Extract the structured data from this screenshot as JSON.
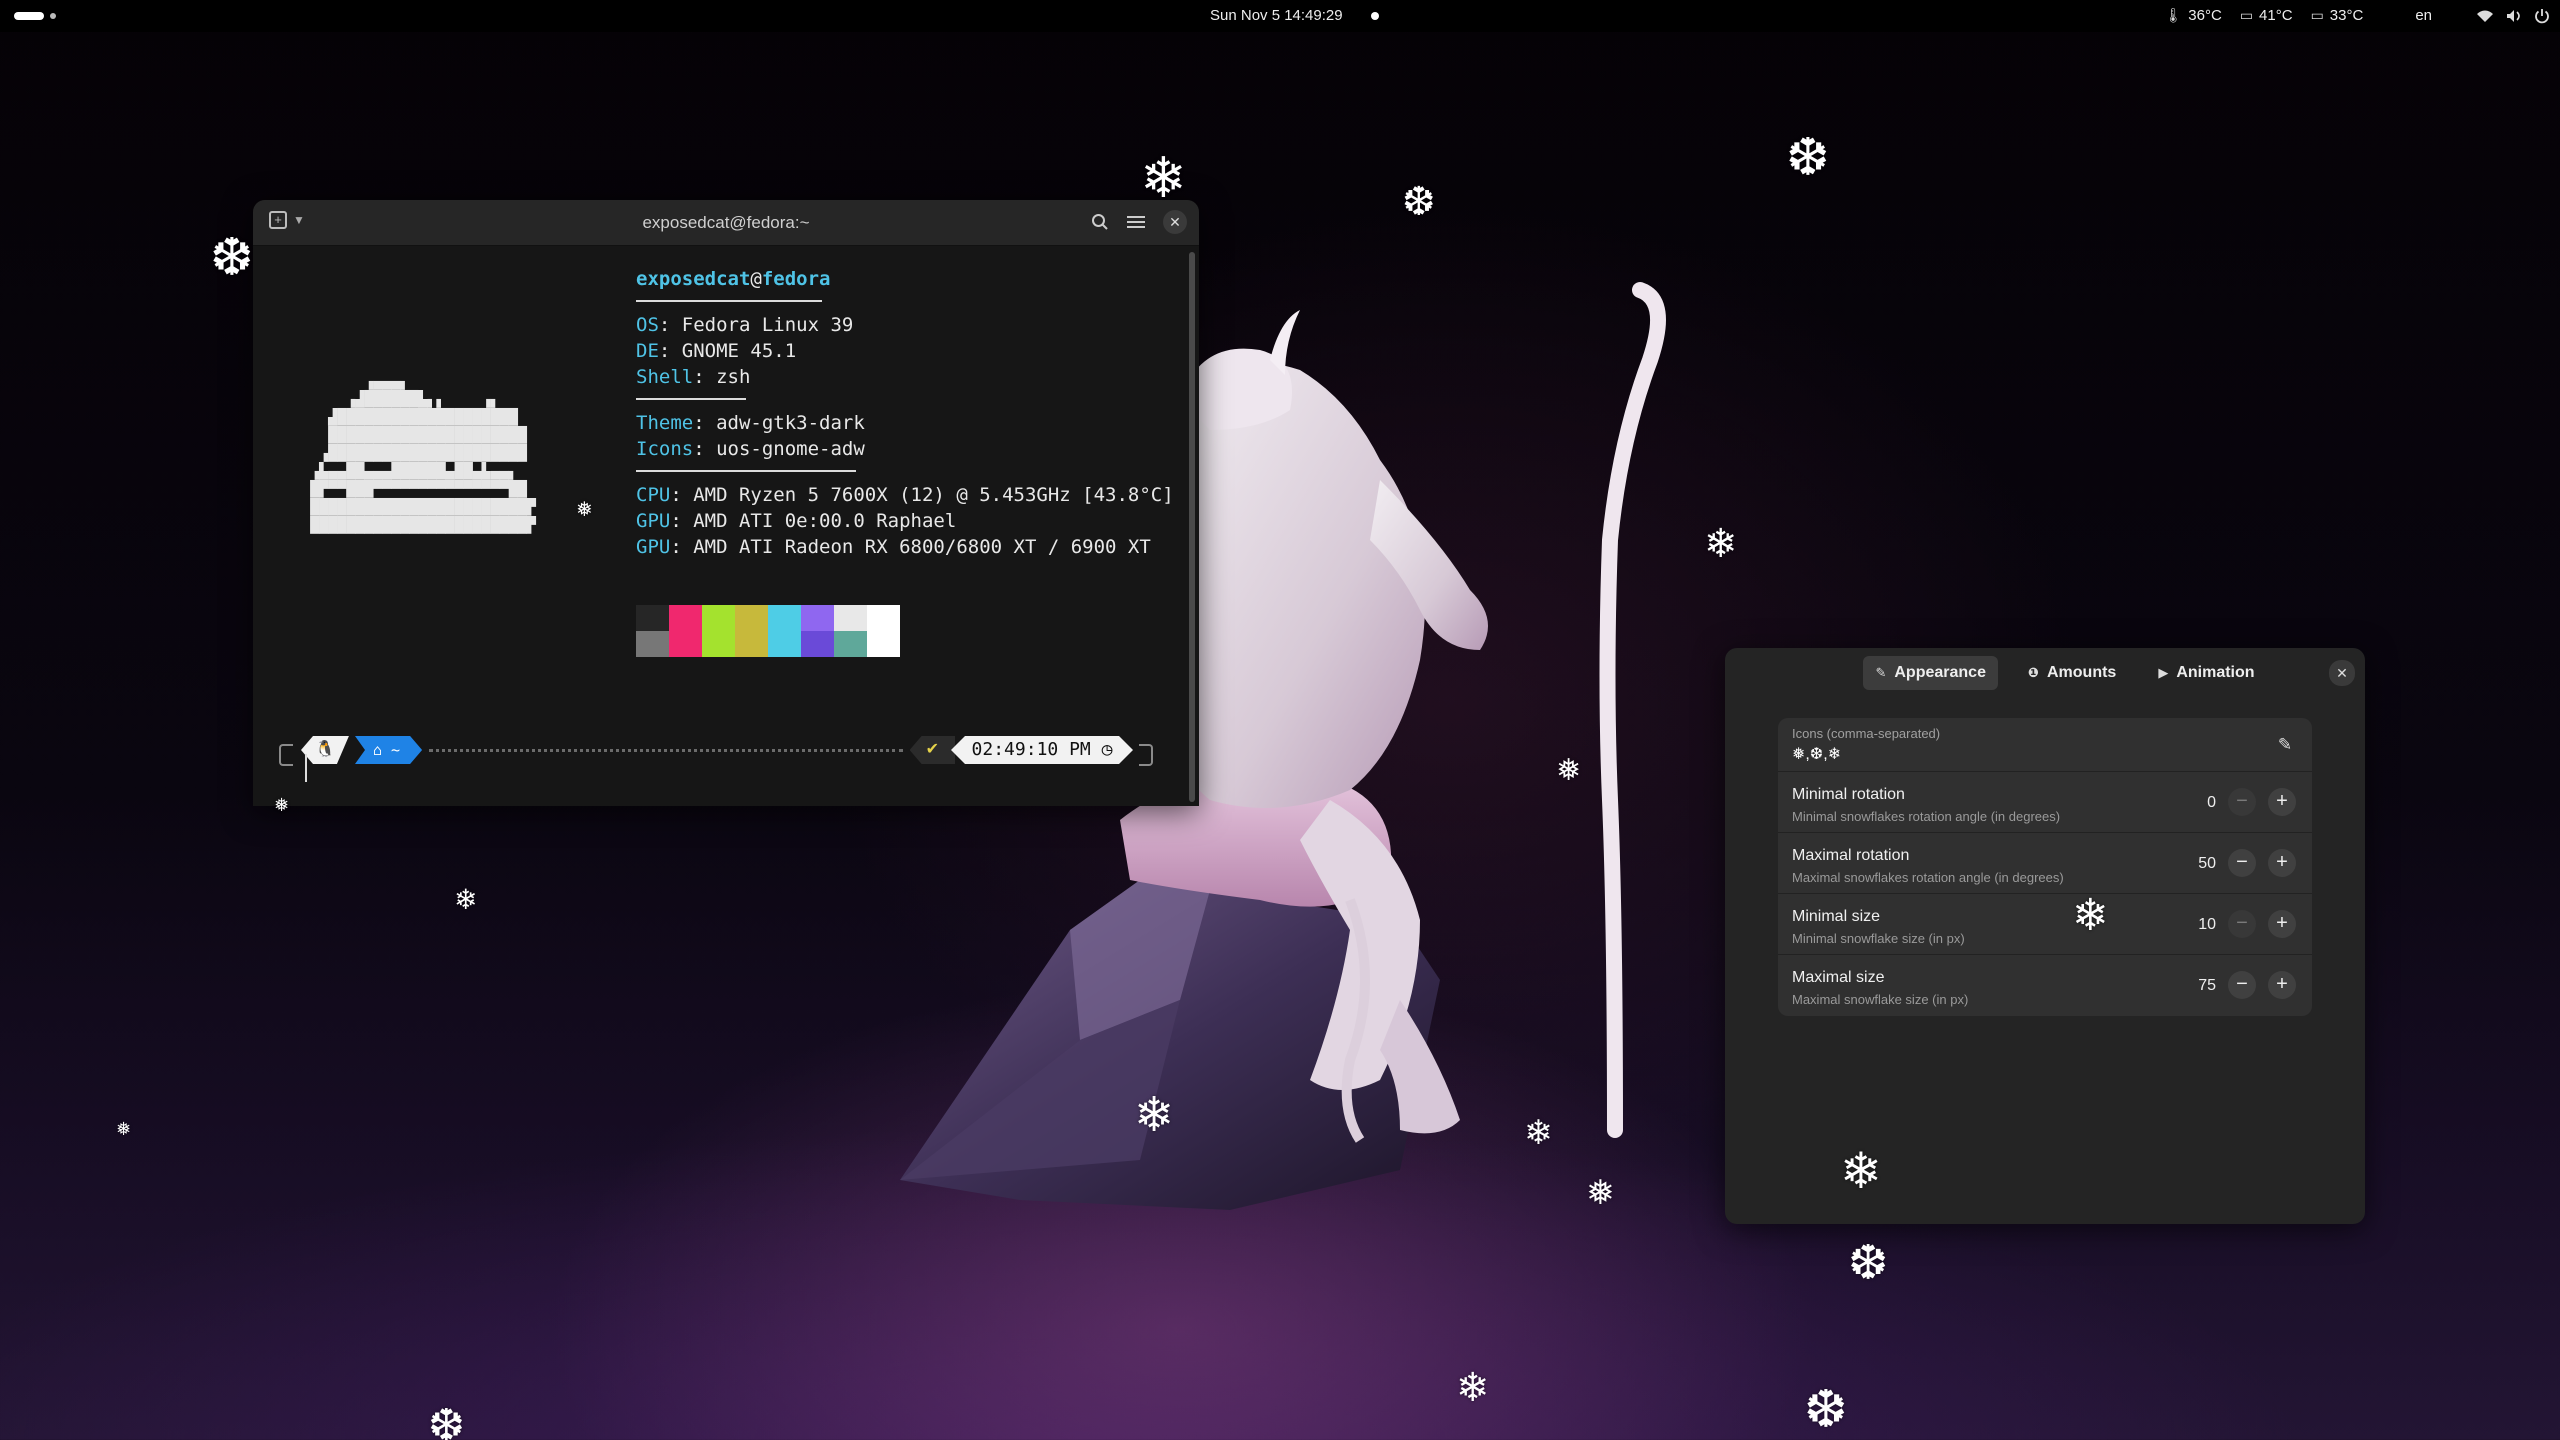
{
  "topbar": {
    "clock": "Sun Nov 5  14:49:29",
    "temps": [
      "36°C",
      "41°C",
      "33°C"
    ],
    "keyboard": "en"
  },
  "terminal": {
    "title": "exposedcat@fedora:~",
    "info": {
      "user": "exposedcat",
      "host": "fedora",
      "os_key": "OS",
      "os": "Fedora Linux 39",
      "de_key": "DE",
      "de": "GNOME 45.1",
      "shell_key": "Shell",
      "shell": "zsh",
      "theme_key": "Theme",
      "theme": "adw-gtk3-dark",
      "icons_key": "Icons",
      "icons": "uos-gnome-adw",
      "cpu_key": "CPU",
      "cpu": "AMD Ryzen 5 7600X (12) @ 5.453GHz [43.8°C]",
      "gpu1_key": "GPU",
      "gpu1": "AMD ATI 0e:00.0 Raphael",
      "gpu2_key": "GPU",
      "gpu2": "AMD ATI Radeon RX 6800/6800 XT / 6900 XT"
    },
    "palette_top": [
      "#262626",
      "#f0286e",
      "#a4e22e",
      "#c7b93b",
      "#4ecde6",
      "#8f67f0",
      "#e8e8e8",
      "#ffffff"
    ],
    "palette_bottom": [
      "#777777",
      "#f0286e",
      "#a4e22e",
      "#c7b93b",
      "#4ecde6",
      "#6a4ad8",
      "#5fa89a",
      "#ffffff"
    ],
    "prompt": {
      "os_glyph": "🐧",
      "dir": "⌂ ~",
      "status": "✔",
      "time": "02:49:10 PM ◷"
    }
  },
  "prefs": {
    "tabs": [
      {
        "label": "Appearance",
        "icon": "brush-icon",
        "active": true
      },
      {
        "label": "Amounts",
        "icon": "numeric-icon",
        "active": false
      },
      {
        "label": "Animation",
        "icon": "play-icon",
        "active": false
      }
    ],
    "icons_field": {
      "label": "Icons (comma-separated)",
      "value": "❅,❆,❄"
    },
    "rows": [
      {
        "title": "Minimal rotation",
        "subtitle": "Minimal snowflakes rotation angle (in degrees)",
        "value": "0"
      },
      {
        "title": "Maximal rotation",
        "subtitle": "Maximal snowflakes rotation angle (in degrees)",
        "value": "50"
      },
      {
        "title": "Minimal size",
        "subtitle": "Minimal snowflake size (in px)",
        "value": "10"
      },
      {
        "title": "Maximal size",
        "subtitle": "Maximal snowflake size (in px)",
        "value": "75"
      }
    ]
  },
  "snowflakes": {
    "glyph_a": "❄",
    "glyph_b": "❆",
    "glyph_c": "❅"
  }
}
